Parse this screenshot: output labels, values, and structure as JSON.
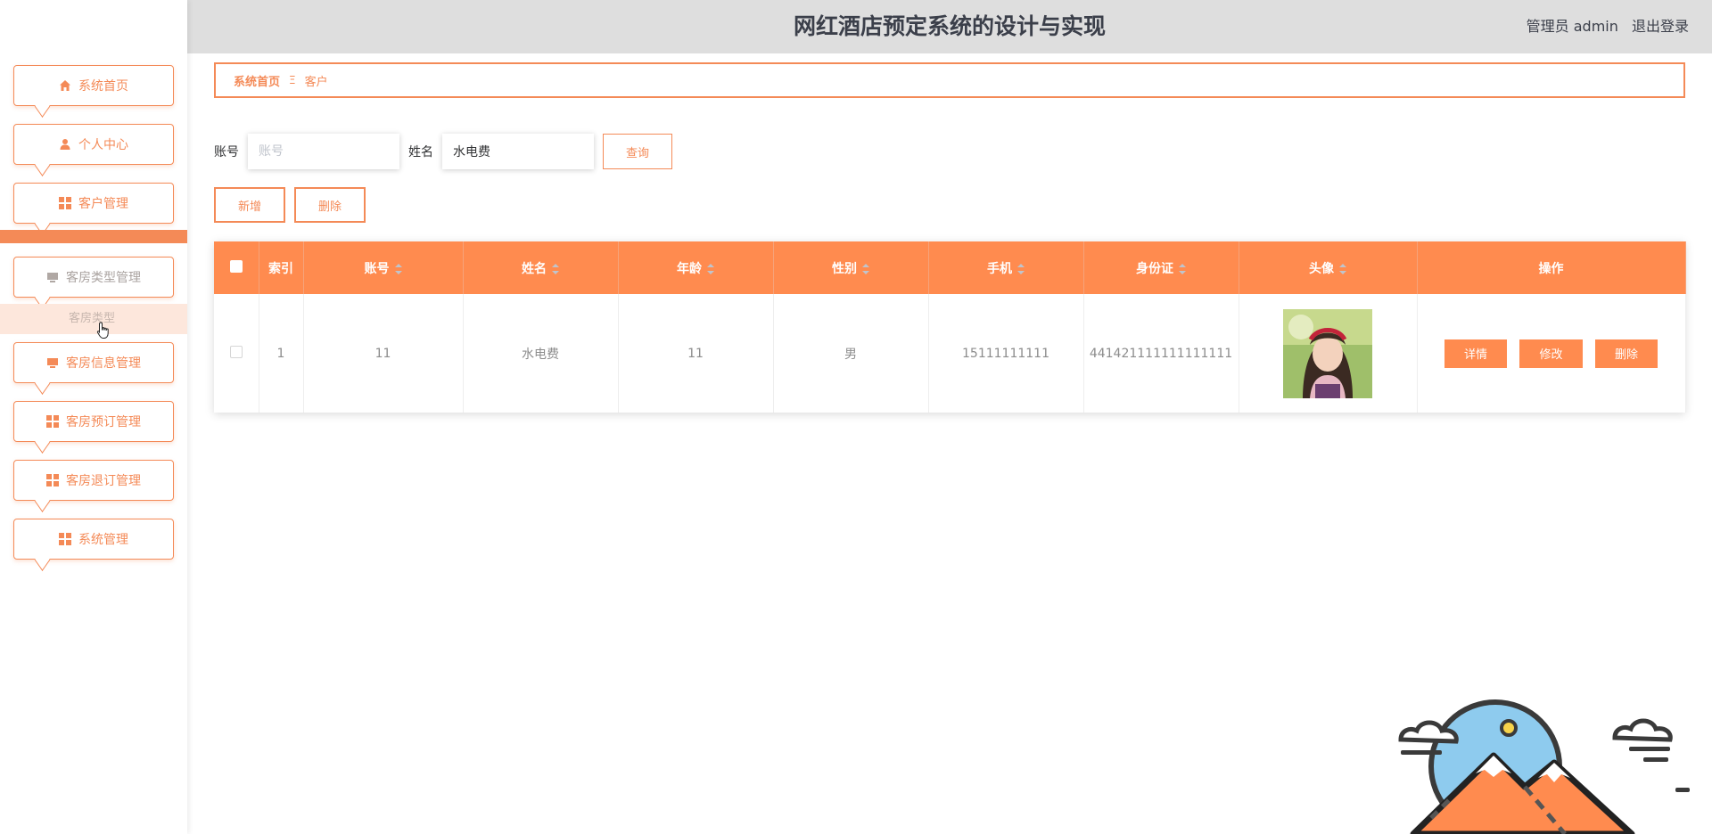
{
  "header": {
    "title": "网红酒店预定系统的设计与实现",
    "role": "管理员 admin",
    "logout": "退出登录"
  },
  "sidebar": {
    "items": [
      {
        "label": "系统首页",
        "icon": "home-icon"
      },
      {
        "label": "个人中心",
        "icon": "user-icon"
      },
      {
        "label": "客户管理",
        "icon": "grid-icon"
      },
      {
        "label": "客房类型管理",
        "icon": "monitor-icon"
      },
      {
        "label": "客房信息管理",
        "icon": "monitor-icon"
      },
      {
        "label": "客房预订管理",
        "icon": "grid-icon"
      },
      {
        "label": "客房退订管理",
        "icon": "grid-icon"
      },
      {
        "label": "系统管理",
        "icon": "grid-icon"
      }
    ],
    "submenu_label": "客房类型"
  },
  "breadcrumb": {
    "home": "系统首页",
    "separator": "Ξ",
    "current": "客户"
  },
  "search": {
    "account_label": "账号",
    "account_placeholder": "账号",
    "account_value": "",
    "name_label": "姓名",
    "name_value": "水电费",
    "query_button": "查询"
  },
  "actions": {
    "add_button": "新增",
    "delete_button": "删除"
  },
  "table": {
    "columns": [
      "索引",
      "账号",
      "姓名",
      "年龄",
      "性别",
      "手机",
      "身份证",
      "头像",
      "操作"
    ],
    "rows": [
      {
        "index": "1",
        "account": "11",
        "name": "水电费",
        "age": "11",
        "gender": "男",
        "phone": "15111111111",
        "id_card": "441421111111111111"
      }
    ],
    "row_buttons": {
      "detail": "详情",
      "edit": "修改",
      "delete": "删除"
    }
  },
  "colors": {
    "accent": "#ff8b4f",
    "border_accent": "#f48a57",
    "header_bg": "#dedede"
  }
}
